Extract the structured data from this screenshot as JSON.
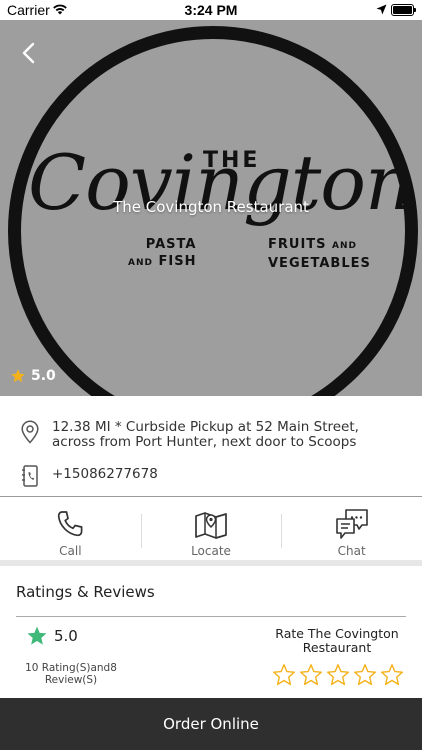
{
  "status_bar": {
    "carrier": "Carrier",
    "time": "3:24 PM"
  },
  "hero": {
    "title": "The Covington Restaurant",
    "rating": "5.0",
    "logo": {
      "the": "THE",
      "script": "Covington",
      "left_line1": "PASTA",
      "left_line2_small": "AND",
      "left_line2": "FISH",
      "right_line1": "FRUITS",
      "right_line1_small": "AND",
      "right_line2": "VEGETABLES"
    }
  },
  "info": {
    "address": "12.38 MI * Curbside Pickup at 52 Main Street, across from Port Hunter, next door to Scoops",
    "phone": "+15086277678"
  },
  "actions": [
    {
      "label": "Call",
      "icon": "phone-icon"
    },
    {
      "label": "Locate",
      "icon": "map-icon"
    },
    {
      "label": "Chat",
      "icon": "chat-icon"
    }
  ],
  "ratings": {
    "title": "Ratings & Reviews",
    "average": "5.0",
    "counts": "10 Rating(S)and8 Review(S)",
    "rate_label": "Rate The Covington Restaurant",
    "star_count": 5
  },
  "order": {
    "label": "Order Online"
  },
  "colors": {
    "accent_green": "#3fb97a",
    "star_gold": "#f3b21b",
    "order_bar": "#2f2f2f",
    "hero_bg": "#9e9e9e"
  }
}
